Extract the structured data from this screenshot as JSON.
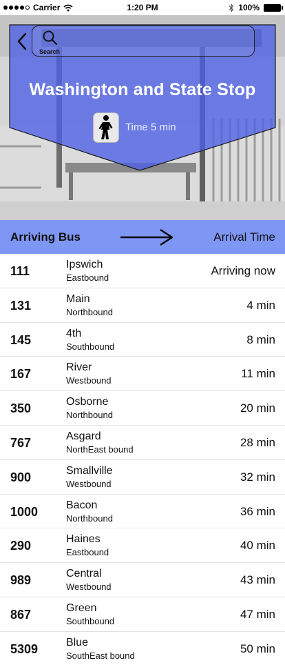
{
  "status_bar": {
    "carrier": "Carrier",
    "time": "1:20 PM",
    "battery": "100%"
  },
  "header": {
    "search_label": "Search",
    "stop_name": "Washington and State Stop",
    "walk_time": "Time  5 min"
  },
  "list_header": {
    "bus_label": "Arriving Bus",
    "time_label": "Arrival Time"
  },
  "colors": {
    "accent": "#7e97f5",
    "banner": "#4d60e6"
  },
  "buses": [
    {
      "number": "111",
      "street": "Ipswich",
      "direction": "Eastbound",
      "arrival": "Arriving now"
    },
    {
      "number": "131",
      "street": "Main",
      "direction": "Northbound",
      "arrival": "4 min"
    },
    {
      "number": "145",
      "street": "4th",
      "direction": "Southbound",
      "arrival": "8 min"
    },
    {
      "number": "167",
      "street": "River",
      "direction": "Westbound",
      "arrival": "11 min"
    },
    {
      "number": "350",
      "street": "Osborne",
      "direction": "Northbound",
      "arrival": "20 min"
    },
    {
      "number": "767",
      "street": "Asgard",
      "direction": "NorthEast bound",
      "arrival": "28 min"
    },
    {
      "number": "900",
      "street": "Smallville",
      "direction": "Westbound",
      "arrival": "32 min"
    },
    {
      "number": "1000",
      "street": "Bacon",
      "direction": "Northbound",
      "arrival": "36 min"
    },
    {
      "number": "290",
      "street": "Haines",
      "direction": "Eastbound",
      "arrival": "40 min"
    },
    {
      "number": "989",
      "street": "Central",
      "direction": "Westbound",
      "arrival": "43 min"
    },
    {
      "number": "867",
      "street": "Green",
      "direction": "Southbound",
      "arrival": "47 min"
    },
    {
      "number": "5309",
      "street": "Blue",
      "direction": "SouthEast bound",
      "arrival": "50 min"
    }
  ]
}
